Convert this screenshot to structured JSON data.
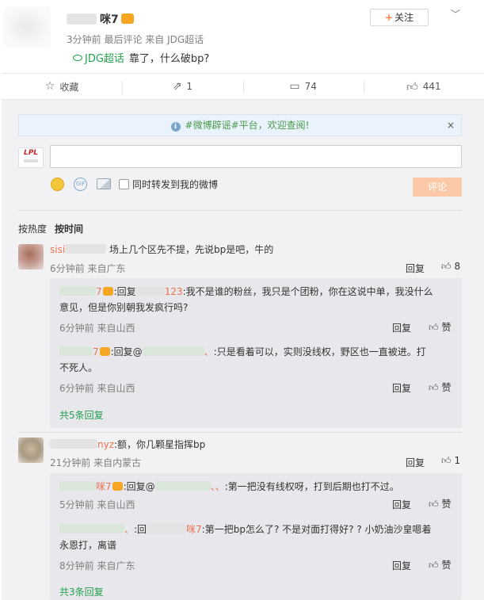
{
  "post": {
    "author_visible": "咪7",
    "meta": "3分钟前 最后评论 来自 JDG超话",
    "topic": "JDG超话",
    "text": "靠了，什么破bp?",
    "follow_label": "关注"
  },
  "actions": [
    {
      "icon": "star-icon",
      "label": "收藏"
    },
    {
      "icon": "repost-icon",
      "label": "1"
    },
    {
      "icon": "comment-icon",
      "label": "74"
    },
    {
      "icon": "like-icon",
      "label": "441"
    }
  ],
  "notice": {
    "text": "#微博辟谣#平台，欢迎查阅!",
    "close": "×"
  },
  "composer": {
    "avatar_text": "LPL",
    "repost_label": "同时转发到我的微博",
    "submit_label": "评论"
  },
  "sort": {
    "hot": "按热度",
    "time": "按时间"
  },
  "comments": [
    {
      "name_visible": "sisi",
      "text": "场上几个区先不提，先说bp是吧，牛的",
      "meta": "6分钟前 来自广东",
      "reply": "回复",
      "likes": "8",
      "replies": [
        {
          "name_visible": "7",
          "text_prefix": ":回复",
          "target_visible": "123",
          "text": ":我不是谁的粉丝，我只是个团粉，你在这说中单，我没什么",
          "text2": "意见，但是你别朝我发疯行吗?",
          "meta": "6分钟前 来自山西",
          "reply": "回复",
          "like": "赞"
        },
        {
          "name_visible": "7",
          "text_prefix": ":回复@",
          "target_visible": "、",
          "text": ":只是看着可以，实则没线权，野区也一直被进。打",
          "text2": "不死人。",
          "meta": "6分钟前 来自山西",
          "reply": "回复",
          "like": "赞"
        }
      ],
      "more": "共5条回复"
    },
    {
      "name_visible": "nyz",
      "text": ":额，你几颗星指挥bp",
      "meta": "21分钟前 来自内蒙古",
      "reply": "回复",
      "likes": "1",
      "replies": [
        {
          "name_visible": "咪7",
          "text_prefix": ":回复@",
          "target_visible": "、、",
          "text": ":第一把没有线权呀，打到后期也打不过。",
          "meta": "5分钟前 来自山西",
          "reply": "回复",
          "like": "赞"
        },
        {
          "name_visible": "、",
          "text_prefix": ":回",
          "target_visible": "咪7",
          "text": ":第一把bp怎么了? 不是对面打得好? ? 小奶油沙皇嗯着",
          "text2": "永恩打，离谱",
          "meta": "8分钟前 来自广东",
          "reply": "回复",
          "like": "赞"
        }
      ],
      "more": "共3条回复"
    }
  ]
}
